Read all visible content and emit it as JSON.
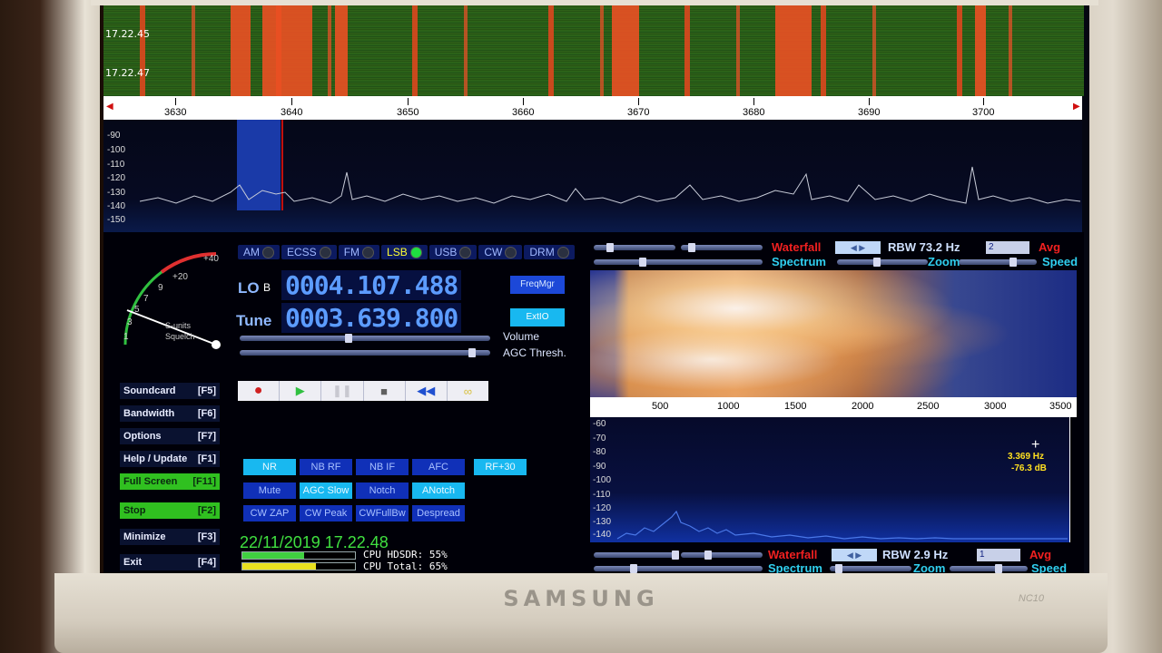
{
  "waterfall_top": {
    "times": [
      "17.22.45",
      "17.22.47"
    ],
    "ticks": [
      "3630",
      "3640",
      "3650",
      "3660",
      "3670",
      "3680",
      "3690",
      "3700"
    ]
  },
  "spectrum_top": {
    "db_labels": [
      "-90",
      "-100",
      "-110",
      "-120",
      "-130",
      "-140",
      "-150"
    ]
  },
  "modes": [
    {
      "label": "AM",
      "active": false
    },
    {
      "label": "ECSS",
      "active": false
    },
    {
      "label": "FM",
      "active": false
    },
    {
      "label": "LSB",
      "active": true
    },
    {
      "label": "USB",
      "active": false
    },
    {
      "label": "CW",
      "active": false
    },
    {
      "label": "DRM",
      "active": false
    }
  ],
  "smeter": {
    "plus20": "+20",
    "plus40": "+40",
    "n9": "9",
    "n7": "7",
    "n5": "5",
    "n3": "3",
    "n1": "1",
    "units": "S-units",
    "squelch": "Squelch"
  },
  "lo": {
    "label": "LO",
    "sub": "B",
    "value": "0004.107.488",
    "button": "FreqMgr"
  },
  "tune": {
    "label": "Tune",
    "value": "0003.639.800",
    "button": "ExtIO"
  },
  "sliders": {
    "volume": "Volume",
    "agc": "AGC Thresh."
  },
  "fkeys": [
    {
      "label": "Soundcard",
      "key": "[F5]",
      "green": false
    },
    {
      "label": "Bandwidth",
      "key": "[F6]",
      "green": false
    },
    {
      "label": "Options",
      "key": "[F7]",
      "green": false
    },
    {
      "label": "Help / Update",
      "key": "[F1]",
      "green": false
    },
    {
      "label": "Full Screen",
      "key": "[F11]",
      "green": true
    },
    {
      "label": "Stop",
      "key": "[F2]",
      "green": true
    },
    {
      "label": "Minimize",
      "key": "[F3]",
      "green": false
    },
    {
      "label": "Exit",
      "key": "[F4]",
      "green": false
    }
  ],
  "dsp": [
    [
      {
        "label": "NR",
        "on": true
      },
      {
        "label": "NB RF",
        "on": false
      },
      {
        "label": "NB IF",
        "on": false
      },
      {
        "label": "AFC",
        "on": false
      },
      {
        "label": "RF+30",
        "on": true
      }
    ],
    [
      {
        "label": "Mute",
        "on": false
      },
      {
        "label": "AGC Slow",
        "on": true
      },
      {
        "label": "Notch",
        "on": false
      },
      {
        "label": "ANotch",
        "on": true
      }
    ],
    [
      {
        "label": "CW ZAP",
        "on": false
      },
      {
        "label": "CW Peak",
        "on": false
      },
      {
        "label": "CWFullBw",
        "on": false
      },
      {
        "label": "Despread",
        "on": false
      }
    ]
  ],
  "datetime": "22/11/2019 17.22.48",
  "cpu": {
    "hdsdr_label": "CPU HDSDR: 55%",
    "hdsdr_fraction": 0.55,
    "hdsdr_color": "#40d040",
    "total_label": "CPU Total: 65%",
    "total_fraction": 0.65,
    "total_color": "#e8e020"
  },
  "rf_controls": {
    "waterfall": "Waterfall",
    "spectrum": "Spectrum",
    "rbw": "RBW 73.2 Hz",
    "zoom": "Zoom",
    "avg_select": "2",
    "avg": "Avg",
    "speed": "Speed"
  },
  "af_waterfall": {
    "ticks": [
      "500",
      "1000",
      "1500",
      "2000",
      "2500",
      "3000",
      "3500"
    ]
  },
  "af_spectrum": {
    "db_labels": [
      "-60",
      "-70",
      "-80",
      "-90",
      "-100",
      "-110",
      "-120",
      "-130",
      "-140"
    ],
    "cursor_freq": "3.369 Hz",
    "cursor_db": "-76.3 dB"
  },
  "af_controls": {
    "waterfall": "Waterfall",
    "spectrum": "Spectrum",
    "rbw": "RBW 2.9 Hz",
    "zoom": "Zoom",
    "avg_select": "1",
    "avg": "Avg",
    "speed": "Speed"
  },
  "laptop": {
    "brand": "SAMSUNG",
    "model": "NC10"
  },
  "colors": {
    "accent_blue": "#5c9cff",
    "active_green": "#30c020",
    "waterfall_red": "#f02020",
    "cyan": "#30d0f0"
  }
}
